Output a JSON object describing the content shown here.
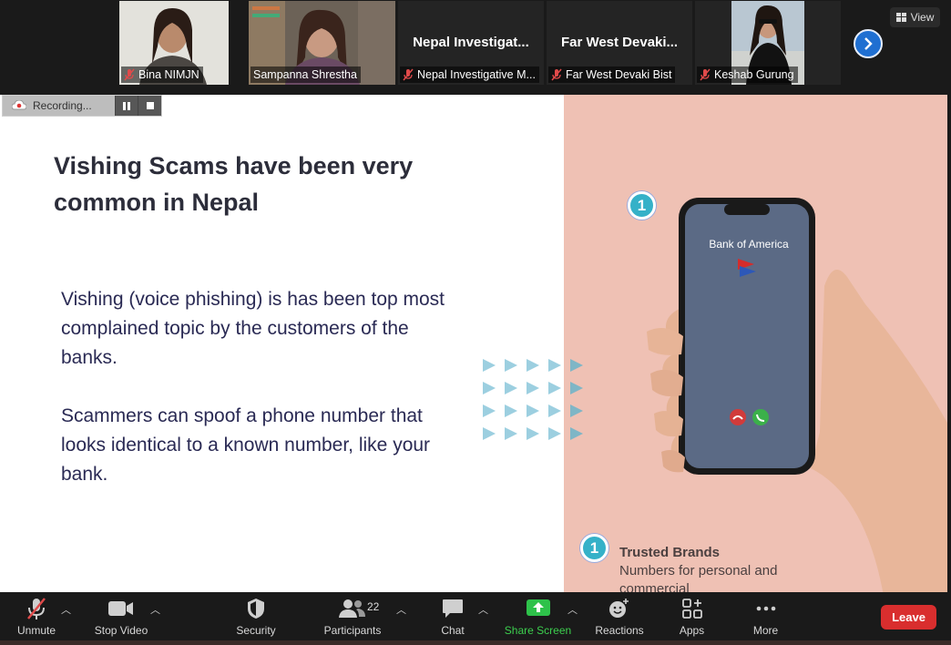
{
  "participants": [
    {
      "name": "Bina NIMJN",
      "muted": true,
      "video": true
    },
    {
      "name": "Sampanna Shrestha",
      "muted": false,
      "video": true,
      "active_speaker": true
    },
    {
      "name": "Nepal Investigative M...",
      "tile_title": "Nepal Investigat...",
      "muted": true,
      "video": false
    },
    {
      "name": "Far West Devaki Bist",
      "tile_title": "Far West Devaki...",
      "muted": true,
      "video": false
    },
    {
      "name": "Keshab Gurung",
      "muted": true,
      "video": true
    }
  ],
  "view_button": "View",
  "recording": {
    "label": "Recording..."
  },
  "slide": {
    "headline": "Vishing Scams have been very common in Nepal",
    "paragraph1": "Vishing (voice phishing) is has been top most complained topic by the customers of the banks.",
    "paragraph2": "Scammers can spoof a phone number that looks identical to a known number, like your bank.",
    "badge_number": "1",
    "phone_caller": "Bank of America",
    "trusted_title": "Trusted Brands",
    "trusted_desc": "Numbers for personal and commercial",
    "colors": {
      "right_panel": "#efc1b4",
      "badge": "#35b1c8",
      "headline": "#2c2d3a",
      "text": "#2a2a54"
    }
  },
  "toolbar": {
    "unmute": "Unmute",
    "stop_video": "Stop Video",
    "security": "Security",
    "participants": "Participants",
    "participants_count": "22",
    "chat": "Chat",
    "share_screen": "Share Screen",
    "reactions": "Reactions",
    "apps": "Apps",
    "more": "More",
    "leave": "Leave"
  }
}
